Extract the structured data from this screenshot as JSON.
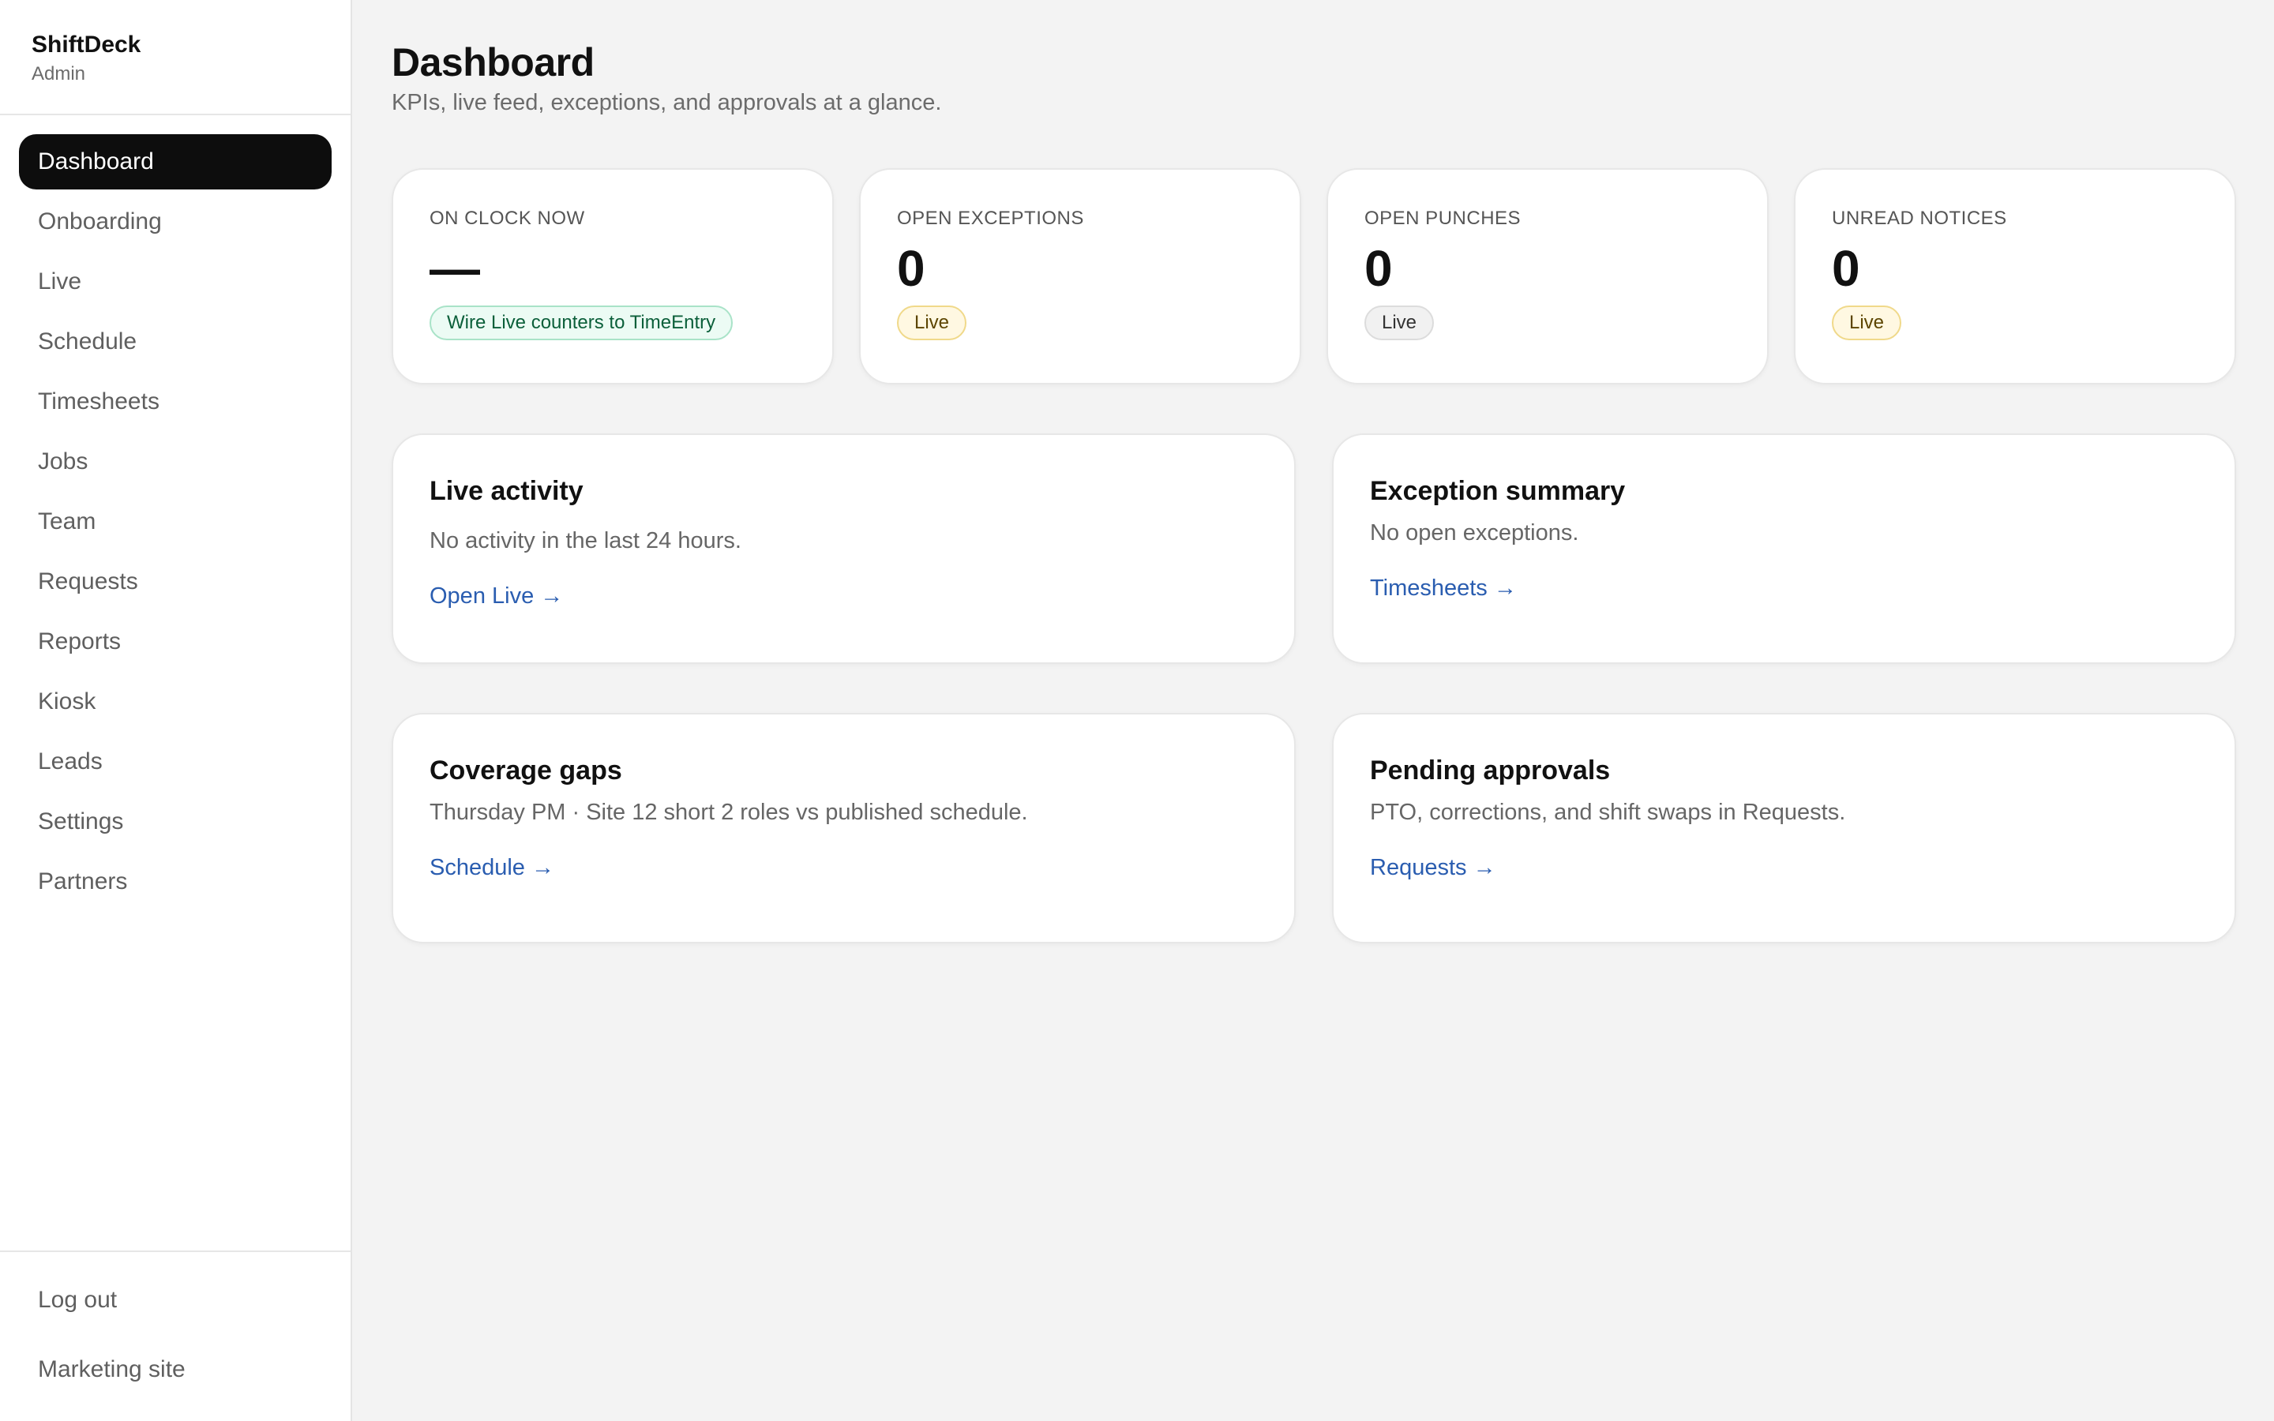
{
  "brand": {
    "name": "ShiftDeck",
    "role": "Admin"
  },
  "sidebar": {
    "items": [
      {
        "label": "Dashboard",
        "active": true
      },
      {
        "label": "Onboarding"
      },
      {
        "label": "Live"
      },
      {
        "label": "Schedule"
      },
      {
        "label": "Timesheets"
      },
      {
        "label": "Jobs"
      },
      {
        "label": "Team"
      },
      {
        "label": "Requests"
      },
      {
        "label": "Reports"
      },
      {
        "label": "Kiosk"
      },
      {
        "label": "Leads"
      },
      {
        "label": "Settings"
      },
      {
        "label": "Partners"
      }
    ],
    "footer": {
      "logout": "Log out",
      "marketing": "Marketing site"
    }
  },
  "header": {
    "title": "Dashboard",
    "subtitle": "KPIs, live feed, exceptions, and approvals at a glance."
  },
  "kpis": [
    {
      "label": "ON CLOCK NOW",
      "value": "—",
      "badge": "Wire Live counters to TimeEntry",
      "badge_color": "#ecfbf4"
    },
    {
      "label": "OPEN EXCEPTIONS",
      "value": "0",
      "badge": "Live",
      "badge_color": "#fff8e2"
    },
    {
      "label": "OPEN PUNCHES",
      "value": "0",
      "badge": "Live",
      "badge_color": "#f1f1f1"
    },
    {
      "label": "UNREAD NOTICES",
      "value": "0",
      "badge": "Live",
      "badge_color": "#fff8e2"
    }
  ],
  "panels": {
    "live_activity": {
      "title": "Live activity",
      "text": "No activity in the last 24 hours.",
      "link": "Open Live →"
    },
    "exception_summary": {
      "title": "Exception summary",
      "text": "No open exceptions.",
      "link": "Timesheets →"
    },
    "coverage_gaps": {
      "title": "Coverage gaps",
      "text": "Thursday PM · Site 12 short 2 roles vs published schedule.",
      "link": "Schedule →"
    },
    "pending_approvals": {
      "title": "Pending approvals",
      "text": "PTO, corrections, and shift swaps in Requests.",
      "link": "Requests →"
    }
  },
  "colors": {
    "active_nav": "#0d0d0d",
    "link": "#2a5db0",
    "background": "#f3f3f3"
  }
}
